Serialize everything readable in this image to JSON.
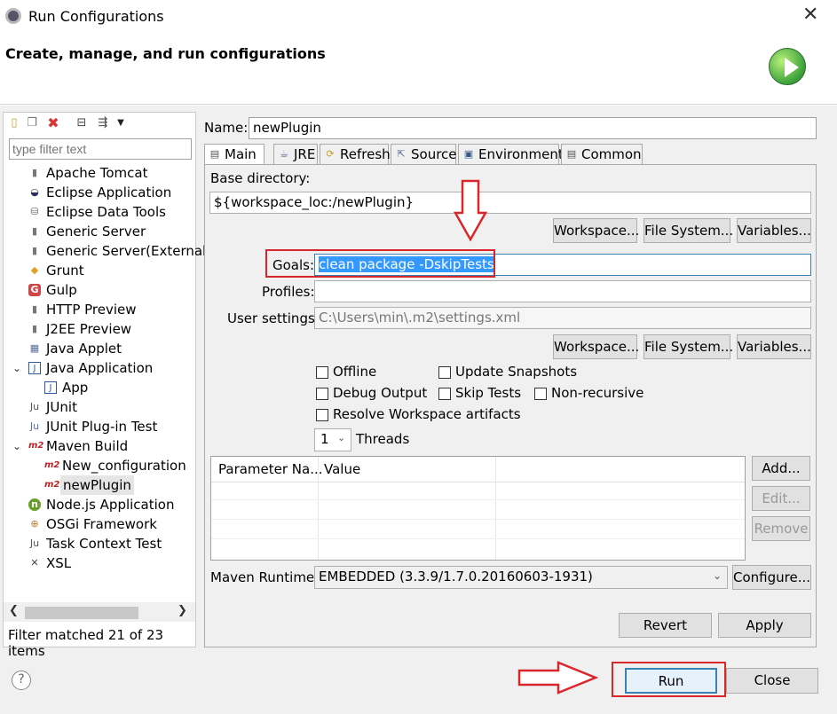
{
  "window": {
    "title": "Run Configurations",
    "close_glyph": "✕"
  },
  "header": {
    "title": "Create, manage, and run configurations"
  },
  "left": {
    "filter_placeholder": "type filter text",
    "tree": [
      {
        "label": "Apache Tomcat",
        "icon": "tomcat-icon"
      },
      {
        "label": "Eclipse Application",
        "icon": "eclipse-icon"
      },
      {
        "label": "Eclipse Data Tools",
        "icon": "database-icon"
      },
      {
        "label": "Generic Server",
        "icon": "server-icon"
      },
      {
        "label": "Generic Server(External",
        "icon": "server-icon"
      },
      {
        "label": "Grunt",
        "icon": "grunt-icon"
      },
      {
        "label": "Gulp",
        "icon": "gulp-icon"
      },
      {
        "label": "HTTP Preview",
        "icon": "server-icon"
      },
      {
        "label": "J2EE Preview",
        "icon": "server-icon"
      },
      {
        "label": "Java Applet",
        "icon": "applet-icon"
      },
      {
        "label": "Java Application",
        "icon": "java-app-icon",
        "expanded": true
      },
      {
        "label": "App",
        "icon": "java-app-icon"
      },
      {
        "label": "JUnit",
        "icon": "junit-icon"
      },
      {
        "label": "JUnit Plug-in Test",
        "icon": "junit-plugin-icon"
      },
      {
        "label": "Maven Build",
        "icon": "maven-icon",
        "expanded": true
      },
      {
        "label": "New_configuration",
        "icon": "maven-icon"
      },
      {
        "label": "newPlugin",
        "icon": "maven-icon",
        "selected": true
      },
      {
        "label": "Node.js Application",
        "icon": "nodejs-icon"
      },
      {
        "label": "OSGi Framework",
        "icon": "osgi-icon"
      },
      {
        "label": "Task Context Test",
        "icon": "task-icon"
      },
      {
        "label": "XSL",
        "icon": "xsl-icon"
      }
    ],
    "filter_status": "Filter matched 21 of 23 items"
  },
  "config": {
    "name_label": "Name:",
    "name_value": "newPlugin",
    "tabs": [
      "Main",
      "JRE",
      "Refresh",
      "Source",
      "Environment",
      "Common"
    ],
    "base_dir_label": "Base directory:",
    "base_dir_value": "${workspace_loc:/newPlugin}",
    "workspace_btn": "Workspace...",
    "filesystem_btn": "File System...",
    "variables_btn": "Variables...",
    "goals_label": "Goals:",
    "goals_value": "clean package -DskipTests",
    "profiles_label": "Profiles:",
    "profiles_value": "",
    "user_settings_label": "User settings:",
    "user_settings_value": "C:\\Users\\min\\.m2\\settings.xml",
    "offline": "Offline",
    "update_snapshots": "Update Snapshots",
    "debug_output": "Debug Output",
    "skip_tests": "Skip Tests",
    "non_recursive": "Non-recursive",
    "resolve_workspace": "Resolve Workspace artifacts",
    "threads_value": "1",
    "threads_label": "Threads",
    "param_col1": "Parameter Na...",
    "param_col2": "Value",
    "add_btn": "Add...",
    "edit_btn": "Edit...",
    "remove_btn": "Remove",
    "runtime_label": "Maven Runtime:",
    "runtime_value": "EMBEDDED (3.3.9/1.7.0.20160603-1931)",
    "configure_btn": "Configure...",
    "revert_btn": "Revert",
    "apply_btn": "Apply"
  },
  "footer": {
    "run_btn": "Run",
    "close_btn": "Close",
    "help_glyph": "?"
  },
  "colors": {
    "annotation_red": "#d9262b",
    "selection_blue": "#3399ff",
    "run_green": "#3aa13a"
  }
}
